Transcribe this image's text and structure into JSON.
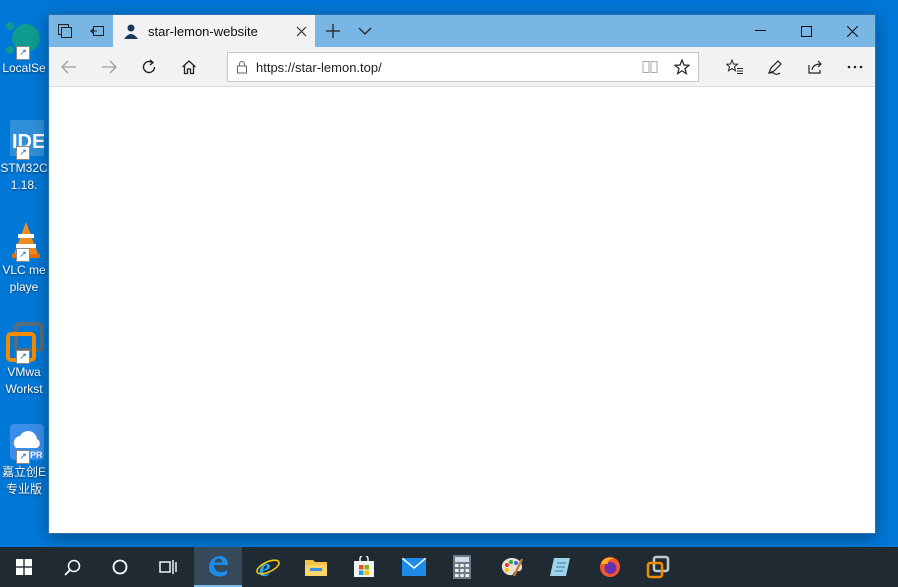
{
  "desktop": {
    "icons": [
      {
        "line1": "LocalSe",
        "line2": ""
      },
      {
        "line1": "STM32C",
        "line2": "1.18."
      },
      {
        "line1": "VLC me",
        "line2": "playe"
      },
      {
        "line1": "VMwa",
        "line2": "Workst"
      },
      {
        "line1": "嘉立创E",
        "line2": "专业版"
      }
    ],
    "ide_glyph": "IDE",
    "pr_glyph": "PR"
  },
  "browser": {
    "tab": {
      "title": "star-lemon-website"
    },
    "address": {
      "url": "https://star-lemon.top/"
    }
  },
  "colors": {
    "desktop": "#0078d7",
    "titlebar": "#79b6e4",
    "taskbar": "#1f2a33"
  }
}
